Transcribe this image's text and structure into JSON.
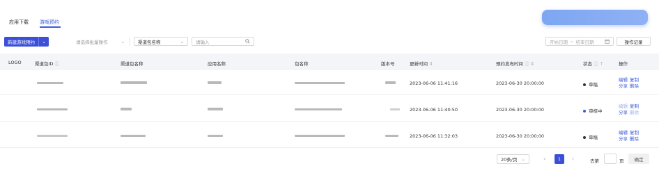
{
  "tabs": [
    {
      "label": "应用下载"
    },
    {
      "label": "游戏预约"
    }
  ],
  "toolbar": {
    "new_button": "新建游戏预约",
    "batch_placeholder": "请选择批量操作",
    "filter_select": "渠道包名称",
    "search_placeholder": "请输入",
    "date_start": "开始日期",
    "date_sep": "~",
    "date_end": "结束日期",
    "log_button": "操作记录"
  },
  "table": {
    "headers": {
      "logo": "LOGO",
      "channel_id": "渠道包ID",
      "channel_name": "渠道包名称",
      "app_name": "应用名称",
      "package": "包名称",
      "version": "版本号",
      "updated": "更新时间",
      "release": "预约发布时间",
      "status": "状态",
      "ops": "操作"
    },
    "rows": [
      {
        "updated": "2023-06-06 11:41:16",
        "release": "2023-06-30 20:00:00",
        "status": "草稿",
        "status_color": "#333333",
        "ops": [
          "编辑",
          "复制",
          "分享",
          "删除"
        ]
      },
      {
        "updated": "2023-06-06 11:40:50",
        "release": "2023-06-30 20:00:00",
        "status": "审核中",
        "status_color": "#3b5bdb",
        "ops": [
          "编辑",
          "复制",
          "分享",
          "删除"
        ]
      },
      {
        "updated": "2023-06-06 11:32:03",
        "release": "2023-06-30 20:00:00",
        "status": "草稿",
        "status_color": "#333333",
        "ops": [
          "编辑",
          "复制",
          "分享",
          "删除"
        ]
      }
    ]
  },
  "pagination": {
    "page_size": "20条/页",
    "current_page": "1",
    "goto_label": "去第",
    "page_suffix": "页",
    "confirm": "确定"
  },
  "colors": {
    "accent": "#3b4fd8"
  }
}
